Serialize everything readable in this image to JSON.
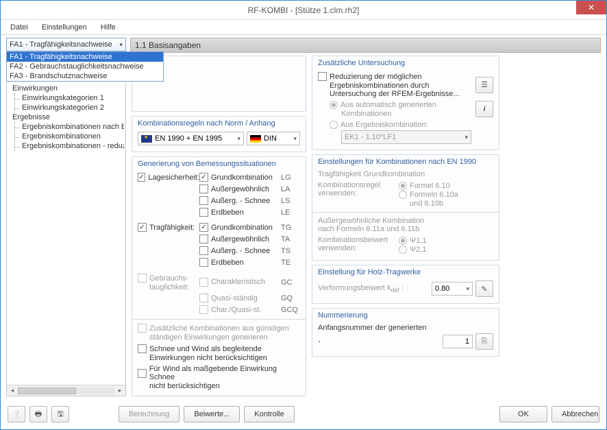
{
  "window": {
    "title": "RF-KOMBI - [Stütze 1.clm.rh2]"
  },
  "menu": {
    "file": "Datei",
    "settings": "Einstellungen",
    "help": "Hilfe"
  },
  "fa_select": {
    "current": "FA1 - Tragfähigkeitsnachweise",
    "options": [
      "FA1 - Tragfähigkeitsnachweise",
      "FA2 - Gebrauchstauglichkeitsnachweise",
      "FA3 - Brandschutznachweise"
    ]
  },
  "heading": "1.1 Basisangaben",
  "nav": {
    "einw": "Einwirkungen",
    "ek1": "Einwirkungskategorien 1",
    "ek2": "Einwirkungskategorien 2",
    "erg": "Ergebnisse",
    "er1": "Ergebniskombinationen nach Einwirkungen",
    "er2": "Ergebniskombinationen",
    "er3": "Ergebniskombinationen - reduziert"
  },
  "norm": {
    "title": "Kombinationsregeln nach Norm / Anhang",
    "code": "EN 1990 + EN 1995",
    "annex": "DIN"
  },
  "gen": {
    "title": "Generierung von Bemessungssituationen",
    "lagesicherheit": "Lagesicherheit:",
    "tragfaehigkeit": "Tragfähigkeit:",
    "gebrauch_a": "Gebrauchs-",
    "gebrauch_b": "tauglichkeit:",
    "items": {
      "grund": "Grundkombination",
      "ausser": "Außergewöhnlich",
      "schnee": "Außerg. - Schnee",
      "erdbeben": "Erdbeben",
      "char": "Charakteristisch",
      "quasi": "Quasi-ständig",
      "charquasi": "Char./Quasi-st."
    },
    "abbr": {
      "lg": "LG",
      "la": "LA",
      "ls": "LS",
      "le": "LE",
      "tg": "TG",
      "ta": "TA",
      "ts": "TS",
      "te": "TE",
      "gc": "GC",
      "gq": "GQ",
      "gcq": "GCQ"
    },
    "extra1a": "Zusätzliche Kombinationen aus günstigen",
    "extra1b": "ständigen Einwirkungen generieren",
    "extra2a": "Schnee und Wind als begleitende",
    "extra2b": "Einwirkungen nicht berücksichtigen",
    "extra3a": "Für Wind als maßgebende Einwirkung Schnee",
    "extra3b": "nicht berücksichtigen"
  },
  "zus": {
    "title": "Zusätzliche Untersuchung",
    "reduce1": "Reduzierung der möglichen",
    "reduce2": "Ergebniskombinationen durch",
    "reduce3": "Untersuchung der RFEM-Ergebnisse...",
    "auto1": "Aus automatisch generierten",
    "auto2": "Kombinationen",
    "ek": "Aus Ergebniskombination:",
    "ekval": "EK1 - 1.10*LF1"
  },
  "en1990": {
    "title": "Einstellungen für Kombinationen nach EN 1990",
    "sub1": "Tragfähigkeit Grundkombination",
    "rule_a": "Kombinationsregel",
    "rule_b": "verwenden:",
    "f610": "Formel 6.10",
    "f610ab_a": "Formeln 6.10a",
    "f610ab_b": "und 6.10b",
    "sub2a": "Außergewöhnliche Kombination",
    "sub2b": "nach Formeln 6.11a und 6.11b",
    "psi_a": "Kombinationsbeiwert",
    "psi_b": "verwenden:",
    "psi11": "Ψ1,1",
    "psi21": "Ψ2,1"
  },
  "holz": {
    "title": "Einstellung für Holz-Tragwerke",
    "kdef": "Verformungsbeiwert kdef :",
    "val": "0.80"
  },
  "numm": {
    "title": "Nummerierung",
    "line1": "Anfangsnummer der generierten",
    "dash": "-",
    "val": "1"
  },
  "footer": {
    "calc": "Berechnung",
    "beiwerte": "Beiwerte...",
    "kontrolle": "Kontrolle",
    "ok": "OK",
    "cancel": "Abbrechen"
  }
}
